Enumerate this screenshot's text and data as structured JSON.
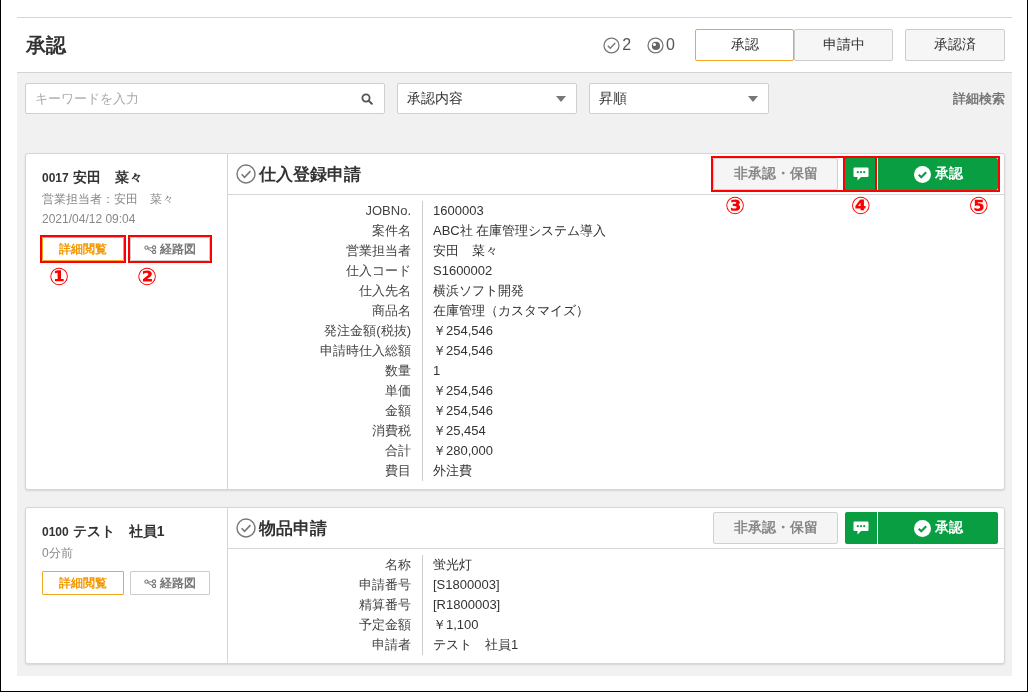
{
  "page": {
    "title": "承認",
    "counters": [
      {
        "kind": "approved",
        "count": "2"
      },
      {
        "kind": "viewed",
        "count": "0"
      }
    ],
    "tabs": [
      {
        "label": "承認",
        "selected": true
      },
      {
        "label": "申請中",
        "selected": false
      }
    ],
    "completed_button": "承認済"
  },
  "filters": {
    "search": {
      "placeholder": "キーワードを入力"
    },
    "selects": [
      {
        "value": "承認内容"
      },
      {
        "value": "昇順"
      }
    ],
    "advanced_search": "詳細検索"
  },
  "requests": [
    {
      "number": "0017",
      "applicant": "安田　菜々",
      "meta": [
        "営業担当者：安田　菜々",
        "2021/04/12 09:04"
      ],
      "links": [
        {
          "kind": "details",
          "label": "詳細閲覧",
          "callout": "①"
        },
        {
          "kind": "route",
          "label": "経路図",
          "callout": "②"
        }
      ],
      "title": "仕入登録申請",
      "reject_button": {
        "label": "非承認・保留",
        "callout": "③"
      },
      "comment_button": {
        "callout": "④"
      },
      "approve_button": {
        "label": "承認",
        "callout": "⑤"
      },
      "fields": [
        {
          "label": "JOBNo.",
          "value": "1600003"
        },
        {
          "label": "案件名",
          "value": "ABC社 在庫管理システム導入"
        },
        {
          "label": "営業担当者",
          "value": "安田　菜々"
        },
        {
          "label": "仕入コード",
          "value": "S1600002"
        },
        {
          "label": "仕入先名",
          "value": "横浜ソフト開発"
        },
        {
          "label": "商品名",
          "value": "在庫管理（カスタマイズ）"
        },
        {
          "label": "発注金額(税抜)",
          "value": "￥254,546"
        },
        {
          "label": "申請時仕入総額",
          "value": "￥254,546"
        },
        {
          "label": "数量",
          "value": "1"
        },
        {
          "label": "単価",
          "value": "￥254,546"
        },
        {
          "label": "金額",
          "value": "￥254,546"
        },
        {
          "label": "消費税",
          "value": "￥25,454"
        },
        {
          "label": "合計",
          "value": "￥280,000"
        },
        {
          "label": "費目",
          "value": "外注費"
        }
      ]
    },
    {
      "number": "0100",
      "applicant": "テスト　社員1",
      "meta": [
        "0分前"
      ],
      "links": [
        {
          "kind": "details",
          "label": "詳細閲覧"
        },
        {
          "kind": "route",
          "label": "経路図"
        }
      ],
      "title": "物品申請",
      "reject_button": {
        "label": "非承認・保留"
      },
      "approve_button": {
        "label": "承認"
      },
      "fields": [
        {
          "label": "名称",
          "value": "蛍光灯"
        },
        {
          "label": "申請番号",
          "value": "[S1800003]"
        },
        {
          "label": "精算番号",
          "value": "[R1800003]"
        },
        {
          "label": "予定金額",
          "value": "￥1,100"
        },
        {
          "label": "申請者",
          "value": "テスト　社員1"
        }
      ]
    }
  ]
}
